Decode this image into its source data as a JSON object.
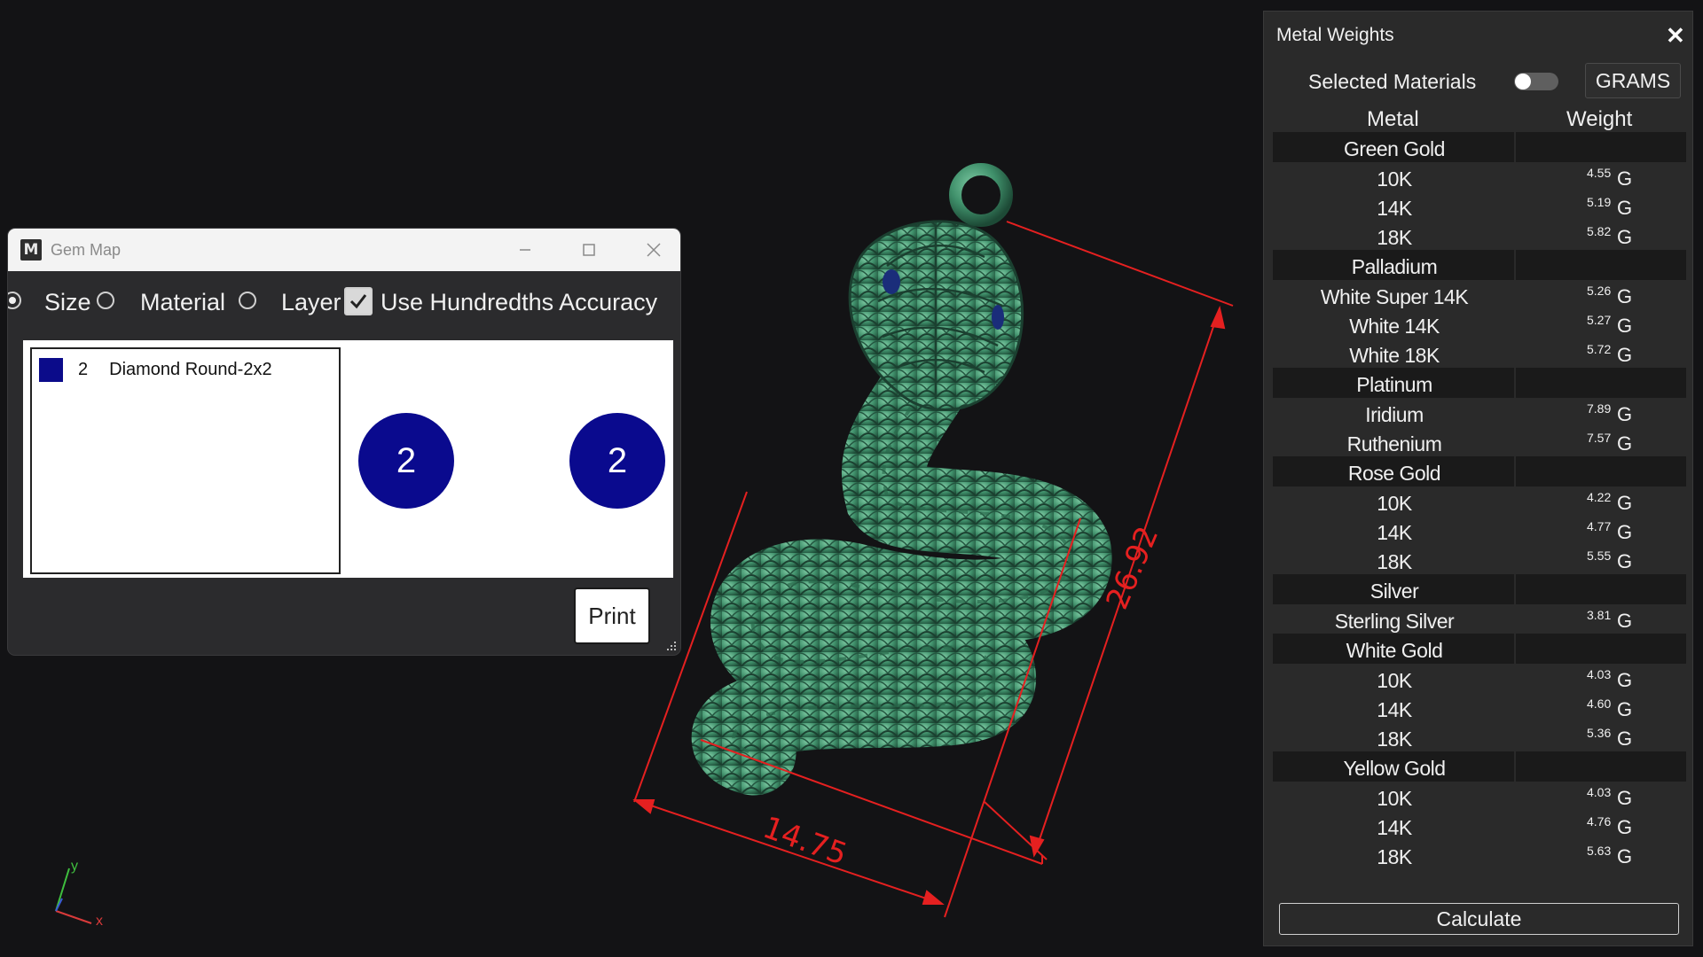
{
  "viewport": {
    "dimensions": {
      "height": "26.92",
      "width": "14.75"
    },
    "axes": {
      "x": "x",
      "y": "y"
    },
    "colors": {
      "model": "#3f8f6a",
      "dimension_lines": "#e52020",
      "background": "#131315"
    }
  },
  "gem_map": {
    "title": "Gem Map",
    "app_icon": "M",
    "options": {
      "size": "Size",
      "material": "Material",
      "layer": "Layer",
      "hundredths": "Use Hundredths Accuracy"
    },
    "list": [
      {
        "count": "2",
        "name": "Diamond Round-2x2",
        "color": "#0b0b8a"
      }
    ],
    "gems": [
      {
        "label": "2"
      },
      {
        "label": "2"
      }
    ],
    "print_label": "Print"
  },
  "metal_weights": {
    "title": "Metal Weights",
    "close_icon": "close-icon",
    "selected_materials": "Selected Materials",
    "units": "GRAMS",
    "header": {
      "metal": "Metal",
      "weight": "Weight"
    },
    "unit_suffix": "G",
    "rows": [
      {
        "metal": "Green Gold",
        "group": true
      },
      {
        "metal": "10K",
        "weight": "4.55"
      },
      {
        "metal": "14K",
        "weight": "5.19"
      },
      {
        "metal": "18K",
        "weight": "5.82"
      },
      {
        "metal": "Palladium",
        "group": true
      },
      {
        "metal": "White Super 14K",
        "weight": "5.26"
      },
      {
        "metal": "White 14K",
        "weight": "5.27"
      },
      {
        "metal": "White 18K",
        "weight": "5.72"
      },
      {
        "metal": "Platinum",
        "group": true
      },
      {
        "metal": "Iridium",
        "weight": "7.89"
      },
      {
        "metal": "Ruthenium",
        "weight": "7.57"
      },
      {
        "metal": "Rose Gold",
        "group": true
      },
      {
        "metal": "10K",
        "weight": "4.22"
      },
      {
        "metal": "14K",
        "weight": "4.77"
      },
      {
        "metal": "18K",
        "weight": "5.55"
      },
      {
        "metal": "Silver",
        "group": true
      },
      {
        "metal": "Sterling Silver",
        "weight": "3.81"
      },
      {
        "metal": "White Gold",
        "group": true
      },
      {
        "metal": "10K",
        "weight": "4.03"
      },
      {
        "metal": "14K",
        "weight": "4.60"
      },
      {
        "metal": "18K",
        "weight": "5.36"
      },
      {
        "metal": "Yellow Gold",
        "group": true
      },
      {
        "metal": "10K",
        "weight": "4.03"
      },
      {
        "metal": "14K",
        "weight": "4.76"
      },
      {
        "metal": "18K",
        "weight": "5.63"
      }
    ],
    "calculate_label": "Calculate"
  }
}
